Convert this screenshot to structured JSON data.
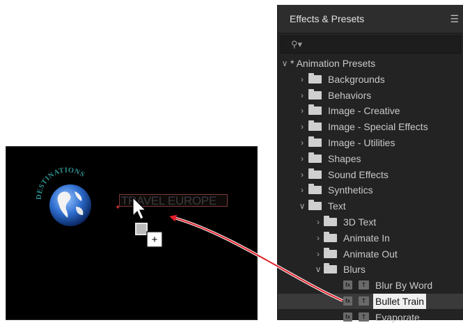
{
  "panel": {
    "title": "Effects & Presets",
    "menu_icon": "hamburger-menu-icon",
    "search": {
      "value": "",
      "icon": "search-icon"
    },
    "tree": [
      {
        "label": "* Animation Presets",
        "level": 0,
        "expanded": true,
        "kind": "root"
      },
      {
        "label": "Backgrounds",
        "level": 1,
        "expanded": false,
        "kind": "folder"
      },
      {
        "label": "Behaviors",
        "level": 1,
        "expanded": false,
        "kind": "folder"
      },
      {
        "label": "Image - Creative",
        "level": 1,
        "expanded": false,
        "kind": "folder"
      },
      {
        "label": "Image - Special Effects",
        "level": 1,
        "expanded": false,
        "kind": "folder"
      },
      {
        "label": "Image - Utilities",
        "level": 1,
        "expanded": false,
        "kind": "folder"
      },
      {
        "label": "Shapes",
        "level": 1,
        "expanded": false,
        "kind": "folder"
      },
      {
        "label": "Sound Effects",
        "level": 1,
        "expanded": false,
        "kind": "folder"
      },
      {
        "label": "Synthetics",
        "level": 1,
        "expanded": false,
        "kind": "folder"
      },
      {
        "label": "Text",
        "level": 1,
        "expanded": true,
        "kind": "folder"
      },
      {
        "label": "3D Text",
        "level": 2,
        "expanded": false,
        "kind": "folder"
      },
      {
        "label": "Animate In",
        "level": 2,
        "expanded": false,
        "kind": "folder"
      },
      {
        "label": "Animate Out",
        "level": 2,
        "expanded": false,
        "kind": "folder"
      },
      {
        "label": "Blurs",
        "level": 2,
        "expanded": true,
        "kind": "folder"
      },
      {
        "label": "Blur By Word",
        "level": 3,
        "kind": "preset"
      },
      {
        "label": "Bullet Train",
        "level": 3,
        "kind": "preset",
        "selected": true
      },
      {
        "label": "Evaporate",
        "level": 3,
        "kind": "preset"
      }
    ]
  },
  "composition": {
    "logo_text": "DESTINATIONS",
    "title_text": "TRAVEL EUROPE",
    "cursor_icon": "copy-cursor-icon",
    "cursor_badge": "+"
  },
  "colors": {
    "arrow": "#e0202a",
    "panel_bg": "#232323",
    "globe": "#2f6fd0"
  }
}
